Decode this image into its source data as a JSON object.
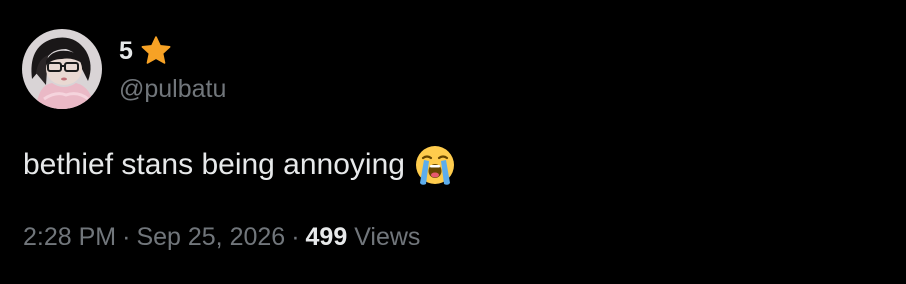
{
  "author": {
    "display_name": "5",
    "badge_icon": "star-icon",
    "handle": "@pulbatu",
    "avatar_icon": "profile-photo"
  },
  "tweet": {
    "text": "bethief stans being annoying",
    "emoji": "loudly-crying-face-icon"
  },
  "meta": {
    "time": "2:28 PM",
    "separator": "·",
    "date": "Sep 25, 2026",
    "views_count": "499",
    "views_label": "Views"
  },
  "colors": {
    "background": "#000000",
    "primary_text": "#e7e9ea",
    "secondary_text": "#71767b",
    "star": "#f7a225"
  }
}
